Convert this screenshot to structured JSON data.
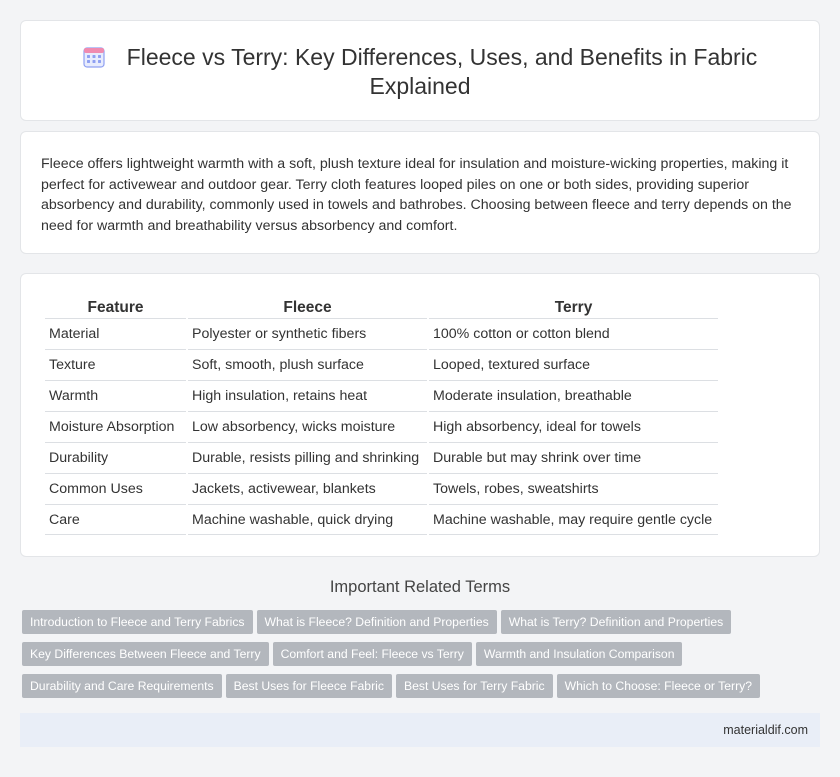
{
  "header": {
    "title": "Fleece vs Terry: Key Differences, Uses, and Benefits in Fabric Explained",
    "icon": "calendar-grid-icon"
  },
  "intro": {
    "text": "Fleece offers lightweight warmth with a soft, plush texture ideal for insulation and moisture-wicking properties, making it perfect for activewear and outdoor gear. Terry cloth features looped piles on one or both sides, providing superior absorbency and durability, commonly used in towels and bathrobes. Choosing between fleece and terry depends on the need for warmth and breathability versus absorbency and comfort."
  },
  "table": {
    "headers": [
      "Feature",
      "Fleece",
      "Terry"
    ],
    "rows": [
      [
        "Material",
        "Polyester or synthetic fibers",
        "100% cotton or cotton blend"
      ],
      [
        "Texture",
        "Soft, smooth, plush surface",
        "Looped, textured surface"
      ],
      [
        "Warmth",
        "High insulation, retains heat",
        "Moderate insulation, breathable"
      ],
      [
        "Moisture Absorption",
        "Low absorbency, wicks moisture",
        "High absorbency, ideal for towels"
      ],
      [
        "Durability",
        "Durable, resists pilling and shrinking",
        "Durable but may shrink over time"
      ],
      [
        "Common Uses",
        "Jackets, activewear, blankets",
        "Towels, robes, sweatshirts"
      ],
      [
        "Care",
        "Machine washable, quick drying",
        "Machine washable, may require gentle cycle"
      ]
    ]
  },
  "related": {
    "title": "Important Related Terms",
    "tags": [
      [
        "Introduction to Fleece and Terry Fabrics",
        "What is Fleece? Definition and Properties",
        "What is Terry? Definition and Properties"
      ],
      [
        "Key Differences Between Fleece and Terry",
        "Comfort and Feel: Fleece vs Terry",
        "Warmth and Insulation Comparison"
      ],
      [
        "Durability and Care Requirements",
        "Best Uses for Fleece Fabric",
        "Best Uses for Terry Fabric",
        "Which to Choose: Fleece or Terry?"
      ]
    ]
  },
  "footer": {
    "site": "materialdif.com"
  },
  "colors": {
    "background": "#f3f4f6",
    "tag_bg": "#b3b7bd",
    "footer_bg": "#e9eef7",
    "icon_accent": "#7b8cf0"
  }
}
